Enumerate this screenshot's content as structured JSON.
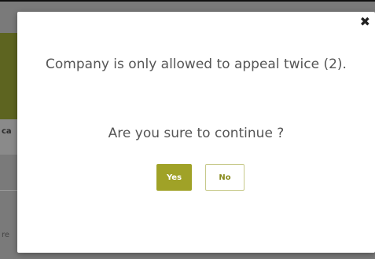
{
  "background": {
    "partial_label_1": "ca",
    "partial_label_2": "re"
  },
  "dialog": {
    "close_icon": "close-icon",
    "message": "Company is only allowed to appeal twice (2).",
    "question": "Are you sure to continue ?",
    "yes_label": "Yes",
    "no_label": "No"
  },
  "colors": {
    "accent": "#a0a227",
    "text": "#555555",
    "overlay": "#7a7a7a"
  }
}
